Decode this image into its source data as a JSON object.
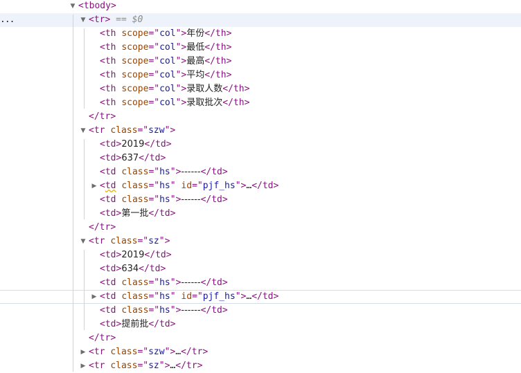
{
  "lines": [
    {
      "indent": 0,
      "kind": "open",
      "tag": "tbody",
      "toggle": "down"
    },
    {
      "indent": 1,
      "kind": "open",
      "tag": "tr",
      "toggle": "down",
      "suffix": "== $0",
      "selected": true,
      "dots": "..."
    },
    {
      "indent": 2,
      "kind": "element",
      "tag": "th",
      "attrs": [
        {
          "name": "scope",
          "value": "col"
        }
      ],
      "text": "年份"
    },
    {
      "indent": 2,
      "kind": "element",
      "tag": "th",
      "attrs": [
        {
          "name": "scope",
          "value": "col"
        }
      ],
      "text": "最低"
    },
    {
      "indent": 2,
      "kind": "element",
      "tag": "th",
      "attrs": [
        {
          "name": "scope",
          "value": "col"
        }
      ],
      "text": "最高"
    },
    {
      "indent": 2,
      "kind": "element",
      "tag": "th",
      "attrs": [
        {
          "name": "scope",
          "value": "col"
        }
      ],
      "text": "平均"
    },
    {
      "indent": 2,
      "kind": "element",
      "tag": "th",
      "attrs": [
        {
          "name": "scope",
          "value": "col"
        }
      ],
      "text": "录取人数"
    },
    {
      "indent": 2,
      "kind": "element",
      "tag": "th",
      "attrs": [
        {
          "name": "scope",
          "value": "col"
        }
      ],
      "text": "录取批次"
    },
    {
      "indent": 1,
      "kind": "close",
      "tag": "tr"
    },
    {
      "indent": 1,
      "kind": "open",
      "tag": "tr",
      "toggle": "down",
      "attrs": [
        {
          "name": "class",
          "value": "szw"
        }
      ]
    },
    {
      "indent": 2,
      "kind": "element",
      "tag": "td",
      "attrs": [],
      "text": "2019"
    },
    {
      "indent": 2,
      "kind": "element",
      "tag": "td",
      "attrs": [],
      "text": "637"
    },
    {
      "indent": 2,
      "kind": "element",
      "tag": "td",
      "attrs": [
        {
          "name": "class",
          "value": "hs"
        }
      ],
      "text": "------"
    },
    {
      "indent": 2,
      "kind": "collapsed",
      "tag": "td",
      "toggle": "right",
      "squiggle": true,
      "attrs": [
        {
          "name": "class",
          "value": "hs"
        },
        {
          "name": "id",
          "value": "pjf_hs"
        }
      ],
      "ellipsis": "…"
    },
    {
      "indent": 2,
      "kind": "element",
      "tag": "td",
      "attrs": [
        {
          "name": "class",
          "value": "hs"
        }
      ],
      "text": "------"
    },
    {
      "indent": 2,
      "kind": "element",
      "tag": "td",
      "attrs": [],
      "text": "第一批"
    },
    {
      "indent": 1,
      "kind": "close",
      "tag": "tr"
    },
    {
      "indent": 1,
      "kind": "open",
      "tag": "tr",
      "toggle": "down",
      "attrs": [
        {
          "name": "class",
          "value": "sz"
        }
      ]
    },
    {
      "indent": 2,
      "kind": "element",
      "tag": "td",
      "attrs": [],
      "text": "2019"
    },
    {
      "indent": 2,
      "kind": "element",
      "tag": "td",
      "attrs": [],
      "text": "634"
    },
    {
      "indent": 2,
      "kind": "element",
      "tag": "td",
      "attrs": [
        {
          "name": "class",
          "value": "hs"
        }
      ],
      "text": "------"
    },
    {
      "indent": 2,
      "kind": "collapsed",
      "tag": "td",
      "toggle": "right",
      "hover": true,
      "attrs": [
        {
          "name": "class",
          "value": "hs"
        },
        {
          "name": "id",
          "value": "pjf_hs"
        }
      ],
      "ellipsis": "…"
    },
    {
      "indent": 2,
      "kind": "element",
      "tag": "td",
      "attrs": [
        {
          "name": "class",
          "value": "hs"
        }
      ],
      "text": "------"
    },
    {
      "indent": 2,
      "kind": "element",
      "tag": "td",
      "attrs": [],
      "text": "提前批"
    },
    {
      "indent": 1,
      "kind": "close",
      "tag": "tr"
    },
    {
      "indent": 1,
      "kind": "collapsed",
      "tag": "tr",
      "toggle": "right",
      "attrs": [
        {
          "name": "class",
          "value": "szw"
        }
      ],
      "ellipsis": "…"
    },
    {
      "indent": 1,
      "kind": "collapsed",
      "tag": "tr",
      "toggle": "right",
      "attrs": [
        {
          "name": "class",
          "value": "sz"
        }
      ],
      "ellipsis": "…"
    }
  ],
  "colors": {
    "tag": "#881280",
    "attribute_name": "#994500",
    "attribute_value": "#1a1aa6",
    "text": "#222222",
    "selected_background": "#eef3fb"
  }
}
